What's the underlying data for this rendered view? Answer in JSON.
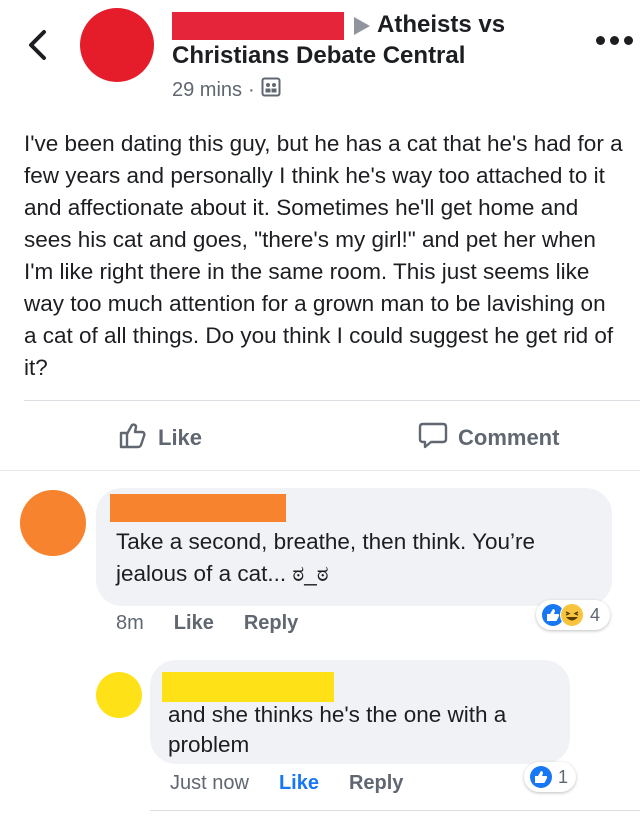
{
  "post": {
    "group_line1": "Atheists vs",
    "group_line2": "Christians Debate Central",
    "time": "29 mins",
    "dot": "·",
    "text": "I've been dating this guy, but he has a cat that he's had for a few years and personally I think he's way too attached to it and affectionate about it. Sometimes he'll get home and sees his cat and goes, \"there's my girl!\" and pet her when I'm like right there in the same room. This just seems like way too much attention for a grown man to be lavishing on a cat of all things. Do you think I could suggest he get rid of it?"
  },
  "actions": {
    "like": "Like",
    "comment": "Comment"
  },
  "comments": [
    {
      "text": "Take a second, breathe, then think. You’re jealous of a cat... ಠ_ಠ",
      "time": "8m",
      "like": "Like",
      "reply": "Reply",
      "reaction_count": "4",
      "reactions": [
        "like-icon",
        "haha-icon"
      ]
    },
    {
      "text": "and she thinks he's the one with a problem",
      "time": "Just now",
      "like": "Like",
      "reply": "Reply",
      "reaction_count": "1",
      "reactions": [
        "like-icon"
      ]
    }
  ],
  "colors": {
    "accent": "#1877f2",
    "redact_red": "#e5253a",
    "redact_orange": "#f7832e",
    "redact_yellow": "#ffe118"
  }
}
